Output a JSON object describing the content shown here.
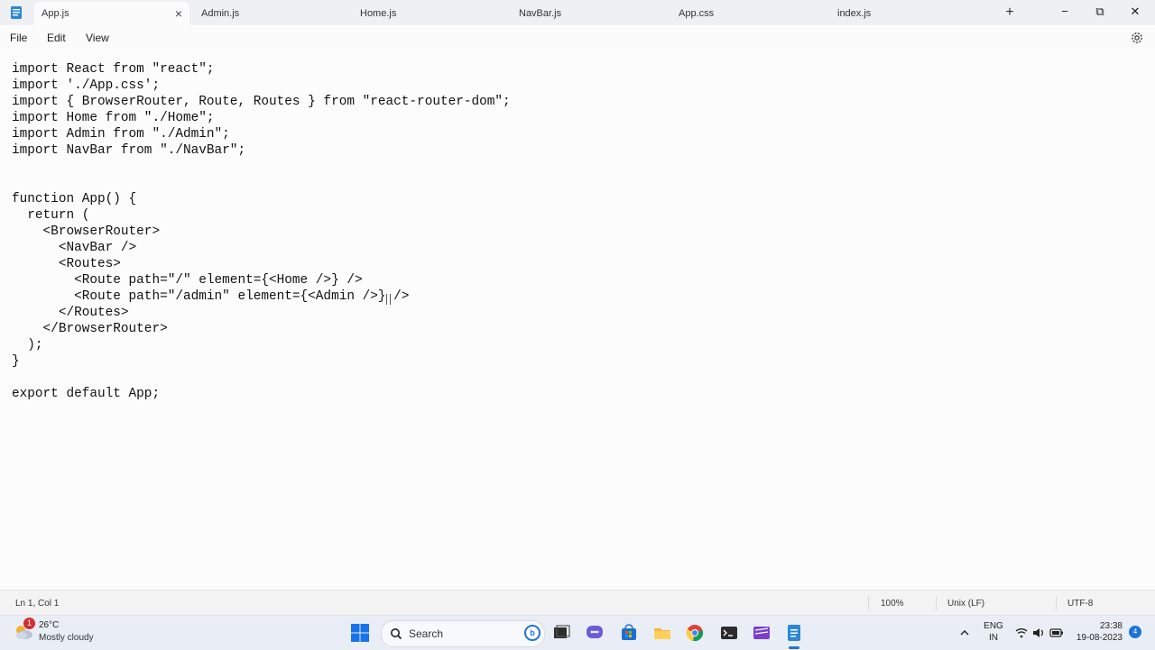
{
  "window": {
    "tabs": [
      {
        "label": "App.js",
        "active": true
      },
      {
        "label": "Admin.js",
        "active": false
      },
      {
        "label": "Home.js",
        "active": false
      },
      {
        "label": "NavBar.js",
        "active": false
      },
      {
        "label": "App.css",
        "active": false
      },
      {
        "label": "index.js",
        "active": false
      }
    ],
    "new_tab_label": "+",
    "minimize_label": "−",
    "maximize_label": "⧉",
    "close_label": "✕"
  },
  "menu": {
    "items": [
      "File",
      "Edit",
      "View"
    ]
  },
  "editor": {
    "content": "import React from \"react\";\nimport './App.css';\nimport { BrowserRouter, Route, Routes } from \"react-router-dom\";\nimport Home from \"./Home\";\nimport Admin from \"./Admin\";\nimport NavBar from \"./NavBar\";\n\n\nfunction App() {\n  return (\n    <BrowserRouter>\n      <NavBar />\n      <Routes>\n        <Route path=\"/\" element={<Home />} />\n        <Route path=\"/admin\" element={<Admin />} />\n      </Routes>\n    </BrowserRouter>\n  );\n}\n\nexport default App;"
  },
  "status": {
    "position": "Ln 1, Col 1",
    "zoom": "100%",
    "line_ending": "Unix (LF)",
    "encoding": "UTF-8"
  },
  "taskbar": {
    "weather_badge": "1",
    "temperature": "26°C",
    "condition": "Mostly cloudy",
    "search_label": "Search",
    "language_top": "ENG",
    "language_bottom": "IN",
    "time": "23:38",
    "date": "19-08-2023",
    "notification_count": "4"
  },
  "colors": {
    "accent": "#1e73d6",
    "badge": "#d32f2f"
  }
}
